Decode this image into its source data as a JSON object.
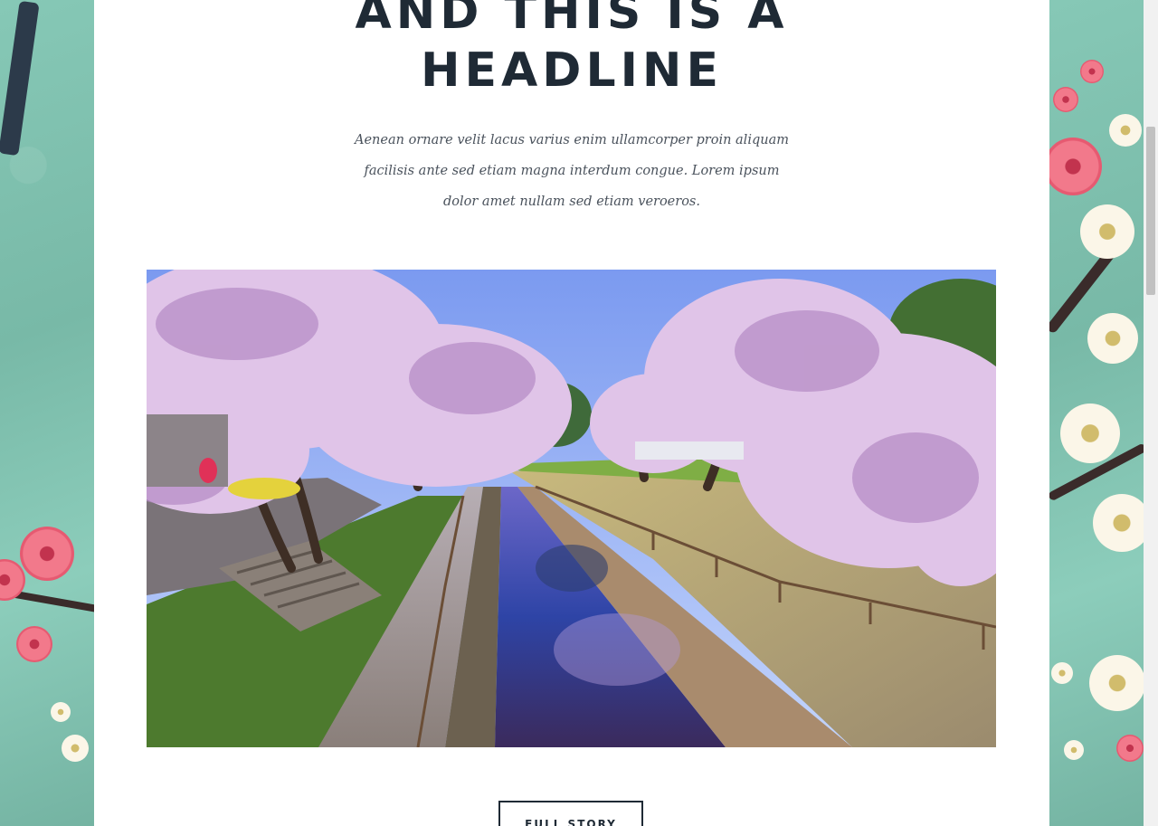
{
  "article": {
    "headline_line1": "AND THIS IS A",
    "headline_line2": "HEADLINE",
    "lede": "Aenean ornare velit lacus varius enim ullamcorper proin aliquam facilisis ante sed etiam magna interdum congue. Lorem ipsum dolor amet nullam sed etiam veroeros.",
    "image_subject": "cherry-blossom-canal-photo",
    "cta_label": "FULL STORY"
  },
  "theme": {
    "background_accent": "#7fbfae",
    "panel_background": "#ffffff",
    "heading_color": "#1f2a35",
    "body_text_color": "#4a525c",
    "blossom_pink": "#f2798b",
    "blossom_white": "#fbf6e8"
  }
}
